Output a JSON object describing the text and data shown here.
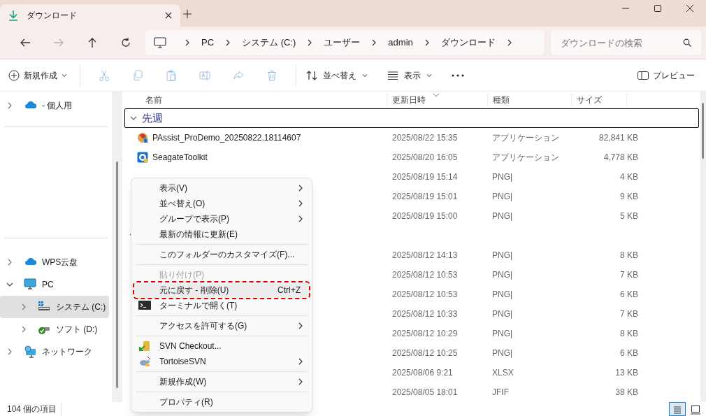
{
  "window": {
    "tab": {
      "title": "ダウンロード",
      "selected": true
    }
  },
  "nav": [
    {
      "kind": "back",
      "disabled": false
    },
    {
      "kind": "forward",
      "disabled": true
    },
    {
      "kind": "up",
      "disabled": false
    },
    {
      "kind": "refresh",
      "disabled": false
    }
  ],
  "breadcrumb": [
    "PC",
    "システム (C:)",
    "ユーザー",
    "admin",
    "ダウンロード"
  ],
  "search": {
    "placeholder": "ダウンロードの検索"
  },
  "toolbar": {
    "new": "新規作成",
    "tools": [
      {
        "kind": "cut",
        "disabled": true
      },
      {
        "kind": "copy",
        "disabled": true
      },
      {
        "kind": "paste",
        "disabled": true
      },
      {
        "kind": "rename",
        "disabled": true
      },
      {
        "kind": "share",
        "disabled": true
      },
      {
        "kind": "delete",
        "disabled": true
      }
    ],
    "sort": "並べ替え",
    "view": "表示",
    "preview": "プレビュー"
  },
  "sidebar": {
    "groups": [
      {
        "items": [
          {
            "kind": "cloud",
            "label": "- 個人用",
            "expanded": false,
            "selected": false
          }
        ]
      },
      {
        "items": [
          {
            "kind": "cloud",
            "label": "WPS云盘",
            "expanded": false,
            "selected": false
          },
          {
            "kind": "pc",
            "label": "PC",
            "expanded": true,
            "selected": false,
            "children": [
              {
                "kind": "drive-c",
                "label": "システム (C:)",
                "expanded": false,
                "selected": true
              },
              {
                "kind": "drive-d",
                "label": "ソフト (D:)",
                "expanded": false,
                "selected": false
              }
            ]
          },
          {
            "kind": "network",
            "label": "ネットワーク",
            "expanded": false,
            "selected": false
          }
        ]
      }
    ]
  },
  "table": {
    "columns": [
      {
        "label": "名前",
        "sorted": false
      },
      {
        "label": "更新日時",
        "sorted": true
      },
      {
        "label": "種類",
        "sorted": false
      },
      {
        "label": "サイズ",
        "sorted": false
      }
    ],
    "groups": [
      {
        "label": "先週",
        "expanded": true,
        "focused": true,
        "rows": [
          {
            "kind": "installer",
            "name": "PAssist_ProDemo_20250822.18114607",
            "modified": "2025/08/22 15:35",
            "type": "アプリケーション",
            "size": "82,841 KB"
          },
          {
            "kind": "toolkit",
            "name": "SeagateToolkit",
            "modified": "2025/08/20 16:05",
            "type": "アプリケーション",
            "size": "4,778 KB"
          },
          {
            "kind": "file",
            "modified": "2025/08/19 15:14",
            "type": "PNG|",
            "size": "4 KB"
          },
          {
            "kind": "file",
            "modified": "2025/08/19 15:01",
            "type": "PNG|",
            "size": "9 KB"
          },
          {
            "kind": "file",
            "modified": "2025/08/19 15:00",
            "type": "PNG|",
            "size": "5 KB"
          }
        ]
      },
      {
        "expanded": true,
        "focused": false,
        "rows": [
          {
            "kind": "file",
            "modified": "2025/08/12 14:13",
            "type": "PNG|",
            "size": "8 KB"
          },
          {
            "kind": "file",
            "modified": "2025/08/12 10:53",
            "type": "PNG|",
            "size": "7 KB"
          },
          {
            "kind": "file",
            "modified": "2025/08/12 10:53",
            "type": "PNG|",
            "size": "6 KB"
          },
          {
            "kind": "file",
            "modified": "2025/08/12 10:33",
            "type": "PNG|",
            "size": "7 KB"
          },
          {
            "kind": "file",
            "modified": "2025/08/12 10:29",
            "type": "PNG|",
            "size": "8 KB"
          },
          {
            "kind": "file",
            "modified": "2025/08/12 10:25",
            "type": "PNG|",
            "size": "6 KB"
          },
          {
            "kind": "file",
            "modified": "2025/08/06 9:21",
            "type": "XLSX",
            "size": "13 KB"
          },
          {
            "kind": "file",
            "modified": "2025/08/05 18:01",
            "type": "JFIF",
            "size": "38 KB"
          }
        ]
      }
    ]
  },
  "context_menu": [
    {
      "kind": "item",
      "label": "表示(V)",
      "submenu": true,
      "disabled": false,
      "highlighted": false
    },
    {
      "kind": "item",
      "label": "並べ替え(O)",
      "submenu": true,
      "disabled": false,
      "highlighted": false
    },
    {
      "kind": "item",
      "label": "グループで表示(P)",
      "submenu": true,
      "disabled": false,
      "highlighted": false
    },
    {
      "kind": "item",
      "label": "最新の情報に更新(E)",
      "submenu": false,
      "disabled": false,
      "highlighted": false
    },
    {
      "kind": "separator"
    },
    {
      "kind": "item",
      "label": "このフォルダーのカスタマイズ(F)...",
      "submenu": false,
      "disabled": false,
      "highlighted": false
    },
    {
      "kind": "separator"
    },
    {
      "kind": "item",
      "label": "貼り付け(P)",
      "submenu": false,
      "disabled": true,
      "highlighted": false
    },
    {
      "kind": "item",
      "label": "元に戻す - 削除(U)",
      "shortcut": "Ctrl+Z",
      "submenu": false,
      "disabled": false,
      "highlighted": true
    },
    {
      "kind": "terminal",
      "label": "ターミナルで開く(T)",
      "submenu": false,
      "disabled": false,
      "highlighted": false
    },
    {
      "kind": "separator"
    },
    {
      "kind": "item",
      "label": "アクセスを許可する(G)",
      "submenu": true,
      "disabled": false,
      "highlighted": false
    },
    {
      "kind": "separator"
    },
    {
      "kind": "svn",
      "label": "SVN Checkout...",
      "submenu": false,
      "disabled": false,
      "highlighted": false
    },
    {
      "kind": "tortoise",
      "label": "TortoiseSVN",
      "submenu": true,
      "disabled": false,
      "highlighted": false
    },
    {
      "kind": "separator"
    },
    {
      "kind": "item",
      "label": "新規作成(W)",
      "submenu": true,
      "disabled": false,
      "highlighted": false
    },
    {
      "kind": "separator"
    },
    {
      "kind": "item",
      "label": "プロパティ(R)",
      "submenu": false,
      "disabled": false,
      "highlighted": false
    }
  ],
  "status_bar": {
    "count": "104 個の項目",
    "view_modes": [
      {
        "kind": "details",
        "selected": true
      },
      {
        "kind": "tiles",
        "selected": false
      }
    ]
  }
}
